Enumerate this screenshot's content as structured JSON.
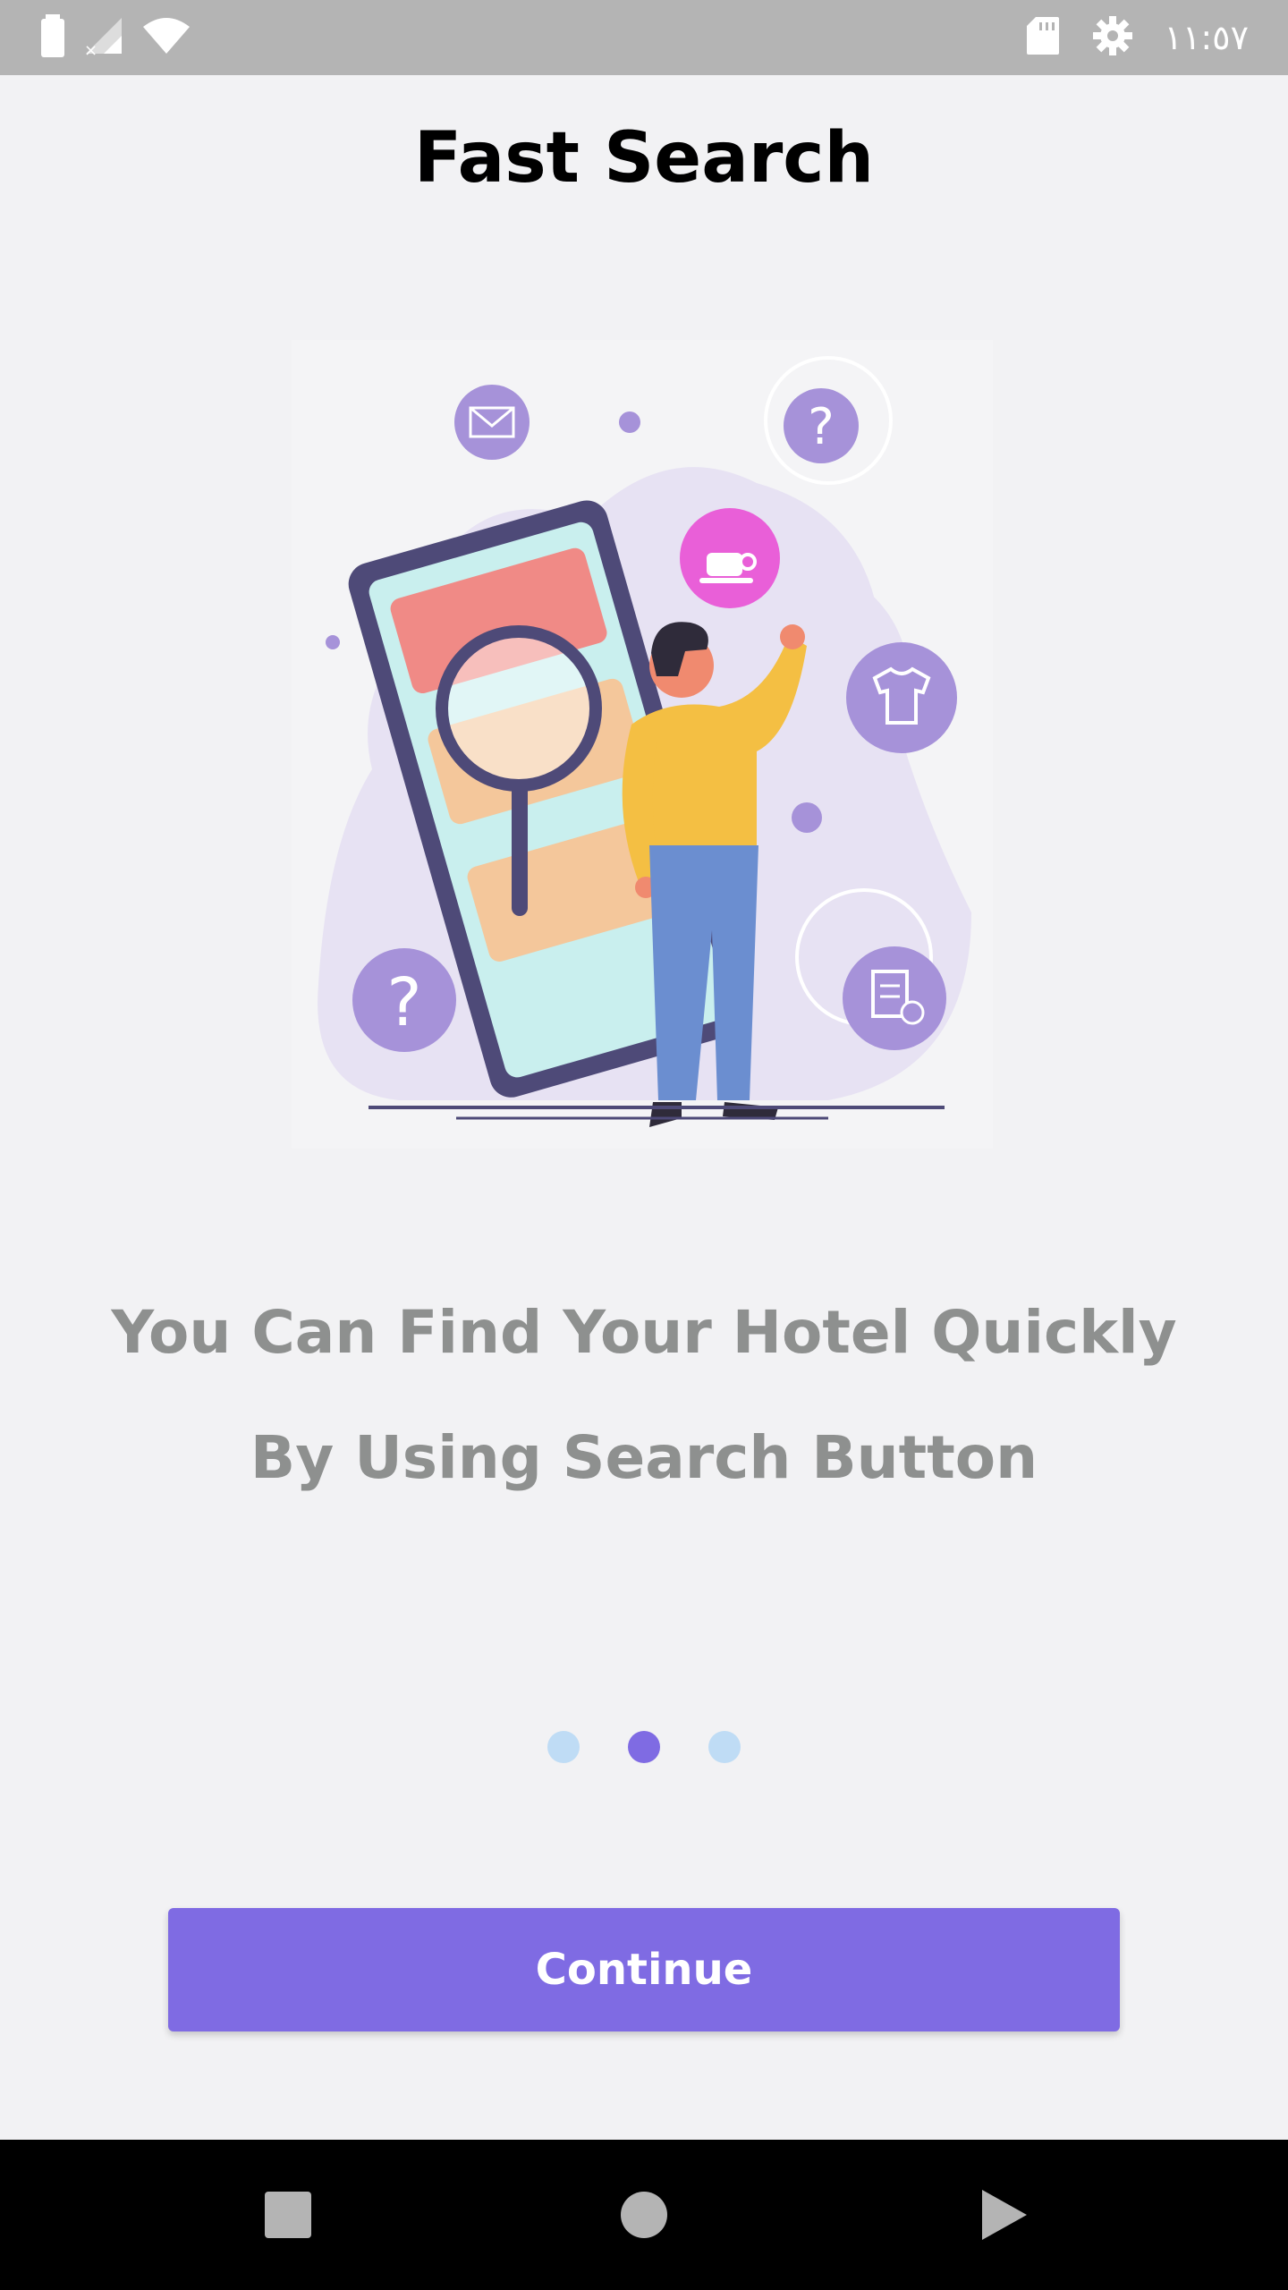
{
  "status_bar": {
    "time": "١١:٥٧",
    "icons": [
      "battery-icon",
      "signal-off-icon",
      "wifi-icon",
      "sd-card-icon",
      "settings-icon"
    ]
  },
  "title": "Fast Search",
  "illustration": {
    "icon": "search-illustration"
  },
  "message": {
    "line1": "You Can Find Your Hotel Quickly",
    "line2": "By Using Search Button"
  },
  "pager": {
    "pages": 3,
    "active": 2,
    "active_color": "#7f6be3",
    "inactive_color": "#bfdcf5"
  },
  "continue_button": {
    "label": "Continue",
    "color": "#7f6be3"
  },
  "nav_bar": {
    "buttons": [
      "recents-square-icon",
      "home-circle-icon",
      "back-triangle-icon"
    ]
  }
}
